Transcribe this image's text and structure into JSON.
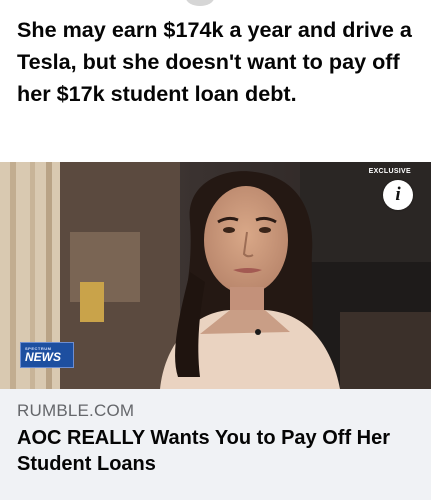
{
  "post": {
    "text": "She may earn $174k a year and drive a Tesla, but she doesn't want to pay off her $17k student loan debt."
  },
  "link_card": {
    "image": {
      "badge": "EXCLUSIVE",
      "info_icon_glyph": "i",
      "channel_logo_small": "SPECTRUM",
      "channel_logo_big": "NEWS"
    },
    "domain": "RUMBLE.COM",
    "headline": "AOC REALLY Wants You to Pay Off Her Student Loans"
  },
  "colors": {
    "caption_background": "#f0f2f5",
    "domain_text": "#65676b",
    "primary_text": "#050505",
    "news_logo_blue": "#1d4fa0"
  }
}
